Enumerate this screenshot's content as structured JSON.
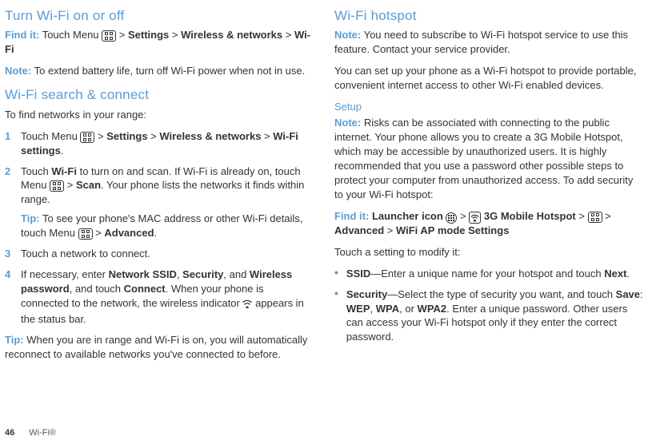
{
  "left": {
    "h1": "Turn Wi-Fi on or off",
    "find_label": "Find it:",
    "find_pre": " Touch Menu ",
    "find_path1": " > ",
    "find_settings": "Settings",
    "find_path2": " > ",
    "find_wireless": "Wireless & networks",
    "find_path3": " > ",
    "find_wifi": "Wi-Fi",
    "note_label": "Note:",
    "note_text": " To extend battery life, turn off Wi-Fi power when not in use.",
    "h2": "Wi-Fi search & connect",
    "intro": "To find networks in your range:",
    "li1_a": "Touch Menu ",
    "li1_b": " > ",
    "li1_settings": "Settings",
    "li1_c": " > ",
    "li1_wireless": "Wireless & networks",
    "li1_d": " > ",
    "li1_wifiset": "Wi-Fi settings",
    "li1_e": ".",
    "li2_a": "Touch ",
    "li2_wifi": "Wi-Fi",
    "li2_b": " to turn on and scan. If Wi-Fi is already on, touch Menu ",
    "li2_c": " > ",
    "li2_scan": "Scan",
    "li2_d": ". Your phone lists the networks it finds within range.",
    "li2_tip_label": "Tip:",
    "li2_tip_a": " To see your phone's MAC address or other Wi-Fi details, touch Menu ",
    "li2_tip_b": " > ",
    "li2_tip_adv": "Advanced",
    "li2_tip_c": ".",
    "li3": "Touch a network to connect.",
    "li4_a": "If necessary, enter ",
    "li4_ssid": "Network SSID",
    "li4_b": ", ",
    "li4_sec": "Security",
    "li4_c": ", and ",
    "li4_pwd": "Wireless password",
    "li4_d": ", and touch ",
    "li4_conn": "Connect",
    "li4_e": ". When your phone is connected to the network, the wireless indicator ",
    "li4_f": " appears in the status bar.",
    "tip2_label": "Tip:",
    "tip2_text": " When you are in range and Wi-Fi is on, you will automatically reconnect to available networks you've connected to before."
  },
  "right": {
    "h1": "Wi-Fi hotspot",
    "note_label": "Note:",
    "note_text": " You need to subscribe to Wi-Fi hotspot service to use this feature. Contact your service provider.",
    "para2": "You can set up your phone as a Wi-Fi hotspot to provide portable, convenient internet access to other Wi-Fi enabled devices.",
    "setup": "Setup",
    "note2_label": "Note:",
    "note2_text": " Risks can be associated with connecting to the public internet. Your phone allows you to create a 3G Mobile Hotspot, which may be accessible by unauthorized users. It is highly recommended that you use a password other possible steps to protect your computer from unauthorized access. To add security to your Wi-Fi hotspot:",
    "find_label": "Find it:",
    "find_a": " ",
    "find_launcher": "Launcher icon",
    "find_b": " ",
    "find_c": " > ",
    "find_d": " ",
    "find_hotspot": "3G Mobile Hotspot",
    "find_e": " > ",
    "find_f": " > ",
    "find_adv": "Advanced",
    "find_g": " > ",
    "find_ap": "WiFi AP mode Settings",
    "para3": "Touch a setting to modify it:",
    "b1_ssid": "SSID",
    "b1_a": "—Enter a unique name for your hotspot and touch ",
    "b1_next": "Next",
    "b1_b": ".",
    "b2_sec": "Security",
    "b2_a": "—Select the type of security you want, and touch ",
    "b2_save": "Save",
    "b2_b": ": ",
    "b2_wep": "WEP",
    "b2_c": ", ",
    "b2_wpa": "WPA",
    "b2_d": ", or ",
    "b2_wpa2": "WPA2",
    "b2_e": ". Enter a unique password. Other users can access your Wi-Fi hotspot only if they enter the correct password."
  },
  "footer": {
    "page": "46",
    "section": "Wi-Fi®"
  }
}
